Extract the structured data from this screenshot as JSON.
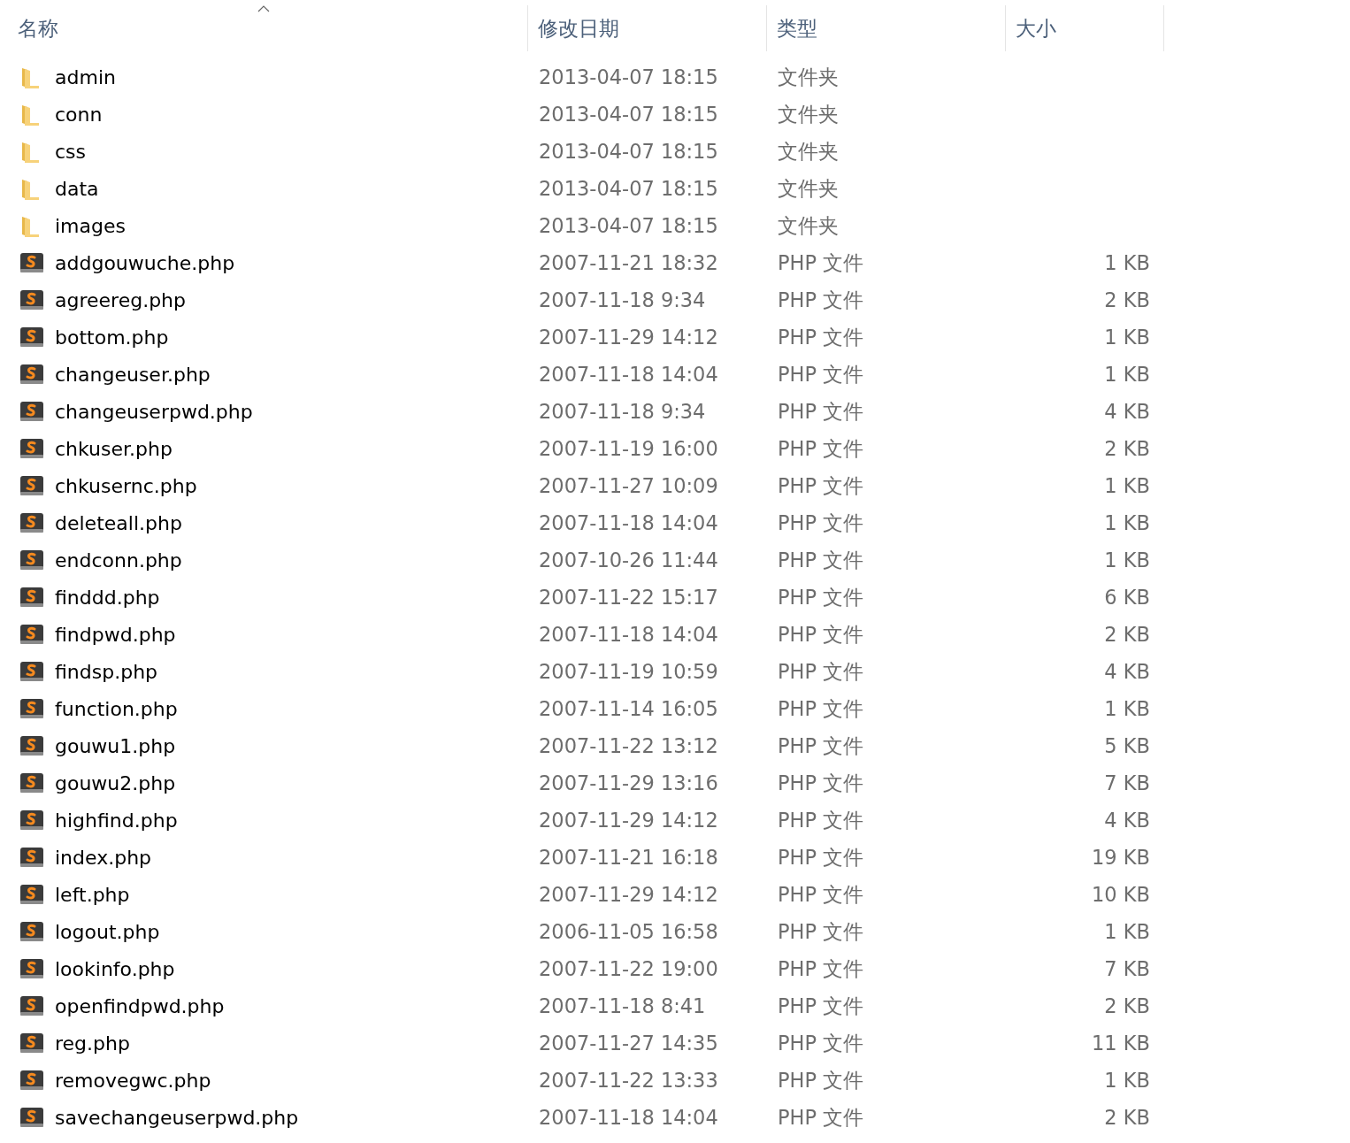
{
  "columns": [
    {
      "label": "名称",
      "sorted": true
    },
    {
      "label": "修改日期",
      "sorted": false
    },
    {
      "label": "类型",
      "sorted": false
    },
    {
      "label": "大小",
      "sorted": false
    }
  ],
  "files": [
    {
      "kind": "folder",
      "name": "admin",
      "date": "2013-04-07 18:15",
      "type": "文件夹"
    },
    {
      "kind": "folder",
      "name": "conn",
      "date": "2013-04-07 18:15",
      "type": "文件夹"
    },
    {
      "kind": "folder",
      "name": "css",
      "date": "2013-04-07 18:15",
      "type": "文件夹"
    },
    {
      "kind": "folder",
      "name": "data",
      "date": "2013-04-07 18:15",
      "type": "文件夹"
    },
    {
      "kind": "folder",
      "name": "images",
      "date": "2013-04-07 18:15",
      "type": "文件夹"
    },
    {
      "kind": "php",
      "name": "addgouwuche.php",
      "date": "2007-11-21 18:32",
      "type": "PHP 文件",
      "size": "1 KB"
    },
    {
      "kind": "php",
      "name": "agreereg.php",
      "date": "2007-11-18 9:34",
      "type": "PHP 文件",
      "size": "2 KB"
    },
    {
      "kind": "php",
      "name": "bottom.php",
      "date": "2007-11-29 14:12",
      "type": "PHP 文件",
      "size": "1 KB"
    },
    {
      "kind": "php",
      "name": "changeuser.php",
      "date": "2007-11-18 14:04",
      "type": "PHP 文件",
      "size": "1 KB"
    },
    {
      "kind": "php",
      "name": "changeuserpwd.php",
      "date": "2007-11-18 9:34",
      "type": "PHP 文件",
      "size": "4 KB"
    },
    {
      "kind": "php",
      "name": "chkuser.php",
      "date": "2007-11-19 16:00",
      "type": "PHP 文件",
      "size": "2 KB"
    },
    {
      "kind": "php",
      "name": "chkusernc.php",
      "date": "2007-11-27 10:09",
      "type": "PHP 文件",
      "size": "1 KB"
    },
    {
      "kind": "php",
      "name": "deleteall.php",
      "date": "2007-11-18 14:04",
      "type": "PHP 文件",
      "size": "1 KB"
    },
    {
      "kind": "php",
      "name": "endconn.php",
      "date": "2007-10-26 11:44",
      "type": "PHP 文件",
      "size": "1 KB"
    },
    {
      "kind": "php",
      "name": "finddd.php",
      "date": "2007-11-22 15:17",
      "type": "PHP 文件",
      "size": "6 KB"
    },
    {
      "kind": "php",
      "name": "findpwd.php",
      "date": "2007-11-18 14:04",
      "type": "PHP 文件",
      "size": "2 KB"
    },
    {
      "kind": "php",
      "name": "findsp.php",
      "date": "2007-11-19 10:59",
      "type": "PHP 文件",
      "size": "4 KB"
    },
    {
      "kind": "php",
      "name": "function.php",
      "date": "2007-11-14 16:05",
      "type": "PHP 文件",
      "size": "1 KB"
    },
    {
      "kind": "php",
      "name": "gouwu1.php",
      "date": "2007-11-22 13:12",
      "type": "PHP 文件",
      "size": "5 KB"
    },
    {
      "kind": "php",
      "name": "gouwu2.php",
      "date": "2007-11-29 13:16",
      "type": "PHP 文件",
      "size": "7 KB"
    },
    {
      "kind": "php",
      "name": "highfind.php",
      "date": "2007-11-29 14:12",
      "type": "PHP 文件",
      "size": "4 KB"
    },
    {
      "kind": "php",
      "name": "index.php",
      "date": "2007-11-21 16:18",
      "type": "PHP 文件",
      "size": "19 KB"
    },
    {
      "kind": "php",
      "name": "left.php",
      "date": "2007-11-29 14:12",
      "type": "PHP 文件",
      "size": "10 KB"
    },
    {
      "kind": "php",
      "name": "logout.php",
      "date": "2006-11-05 16:58",
      "type": "PHP 文件",
      "size": "1 KB"
    },
    {
      "kind": "php",
      "name": "lookinfo.php",
      "date": "2007-11-22 19:00",
      "type": "PHP 文件",
      "size": "7 KB"
    },
    {
      "kind": "php",
      "name": "openfindpwd.php",
      "date": "2007-11-18 8:41",
      "type": "PHP 文件",
      "size": "2 KB"
    },
    {
      "kind": "php",
      "name": "reg.php",
      "date": "2007-11-27 14:35",
      "type": "PHP 文件",
      "size": "11 KB"
    },
    {
      "kind": "php",
      "name": "removegwc.php",
      "date": "2007-11-22 13:33",
      "type": "PHP 文件",
      "size": "1 KB"
    },
    {
      "kind": "php",
      "name": "savechangeuserpwd.php",
      "date": "2007-11-18 14:04",
      "type": "PHP 文件",
      "size": "2 KB"
    }
  ]
}
